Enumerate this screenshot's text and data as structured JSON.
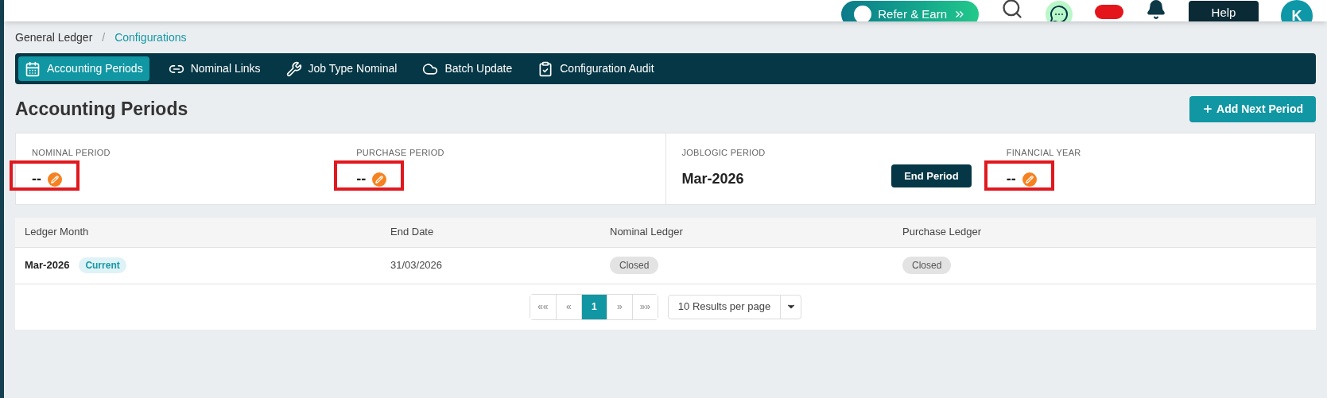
{
  "header": {
    "refer_button": "Refer & Earn",
    "help_button": "Help",
    "avatar": "K"
  },
  "breadcrumb": [
    {
      "label": "General Ledger",
      "link": false
    },
    {
      "label": "Configurations",
      "link": true
    }
  ],
  "breadcrumb_separator": "/",
  "tabs": [
    {
      "label": "Accounting Periods",
      "selected": true
    },
    {
      "label": "Nominal Links",
      "selected": false
    },
    {
      "label": "Job Type Nominal",
      "selected": false
    },
    {
      "label": "Batch Update",
      "selected": false
    },
    {
      "label": "Configuration Audit",
      "selected": false
    }
  ],
  "page_title": "Accounting Periods",
  "add_button": "Add Next Period",
  "periods": [
    {
      "kind": "editable",
      "label": "NOMINAL PERIOD",
      "value": "--",
      "highlighted": true
    },
    {
      "kind": "editable",
      "label": "PURCHASE PERIOD",
      "value": "--",
      "highlighted": true
    },
    {
      "kind": "action",
      "label": "JOBLOGIC PERIOD",
      "value": "Mar-2026",
      "button": "End Period",
      "highlighted": false
    },
    {
      "kind": "editable",
      "label": "FINANCIAL YEAR",
      "value": "--",
      "highlighted": true
    }
  ],
  "table": {
    "columns": [
      "Ledger Month",
      "End Date",
      "Nominal Ledger",
      "Purchase Ledger"
    ],
    "rows": [
      {
        "ledger_month": "Mar-2026",
        "badge": "Current",
        "end_date": "31/03/2026",
        "nominal_ledger": "Closed",
        "purchase_ledger": "Closed"
      }
    ]
  },
  "pagination": {
    "pages": [
      {
        "label": "««",
        "selected": false
      },
      {
        "label": "«",
        "selected": false
      },
      {
        "label": "1",
        "selected": true
      },
      {
        "label": "»",
        "selected": false
      },
      {
        "label": "»»",
        "selected": false
      }
    ],
    "page_size": "10 Results per page"
  }
}
